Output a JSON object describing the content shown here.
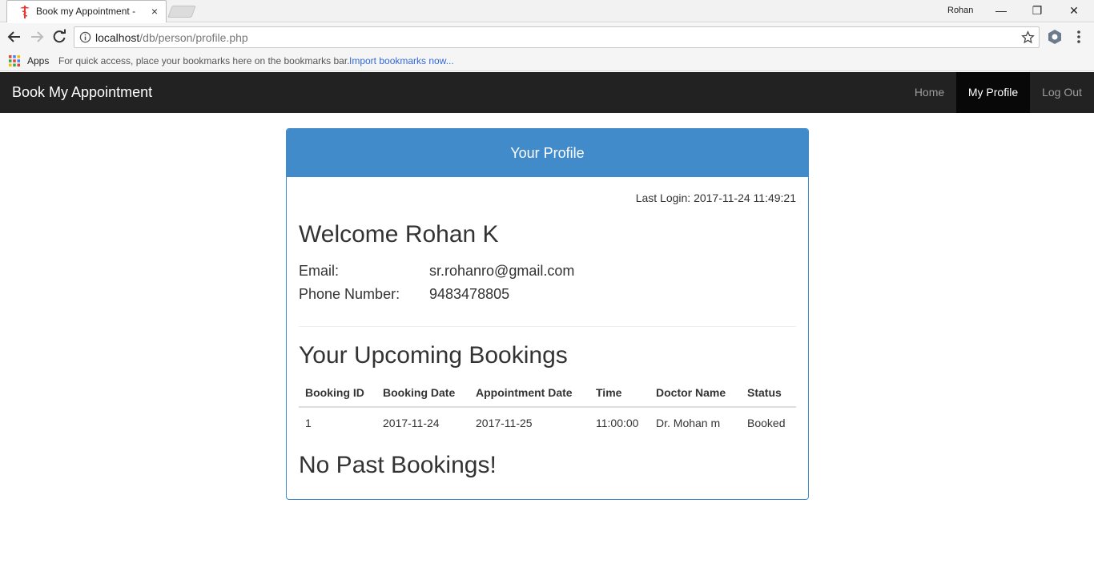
{
  "browser": {
    "tab_title": "Book my Appointment -",
    "tab_close": "×",
    "profile_name": "Rohan",
    "win_minimize": "—",
    "win_restore": "❐",
    "win_close": "✕",
    "url_host": "localhost",
    "url_path": "/db/person/profile.php",
    "bookmarks": {
      "apps_label": "Apps",
      "hint": "For quick access, place your bookmarks here on the bookmarks bar.",
      "import_link": "Import bookmarks now..."
    },
    "favicon_color": "#e53935"
  },
  "navbar": {
    "brand": "Book My Appointment",
    "items": [
      {
        "label": "Home",
        "active": false
      },
      {
        "label": "My Profile",
        "active": true
      },
      {
        "label": "Log Out",
        "active": false
      }
    ]
  },
  "profile": {
    "heading": "Your Profile",
    "last_login": "Last Login: 2017-11-24 11:49:21",
    "welcome": "Welcome Rohan K",
    "email_label": "Email:",
    "email_value": "sr.rohanro@gmail.com",
    "phone_label": "Phone Number:",
    "phone_value": "9483478805",
    "upcoming_title": "Your Upcoming Bookings",
    "past_title": "No Past Bookings!"
  },
  "bookings": {
    "columns": [
      "Booking ID",
      "Booking Date",
      "Appointment Date",
      "Time",
      "Doctor Name",
      "Status"
    ],
    "rows": [
      [
        "1",
        "2017-11-24",
        "2017-11-25",
        "11:00:00",
        "Dr. Mohan m",
        "Booked"
      ]
    ]
  },
  "colors": {
    "navbar_bg": "#222222",
    "panel_primary": "#428bca",
    "link": "#3367d6"
  }
}
